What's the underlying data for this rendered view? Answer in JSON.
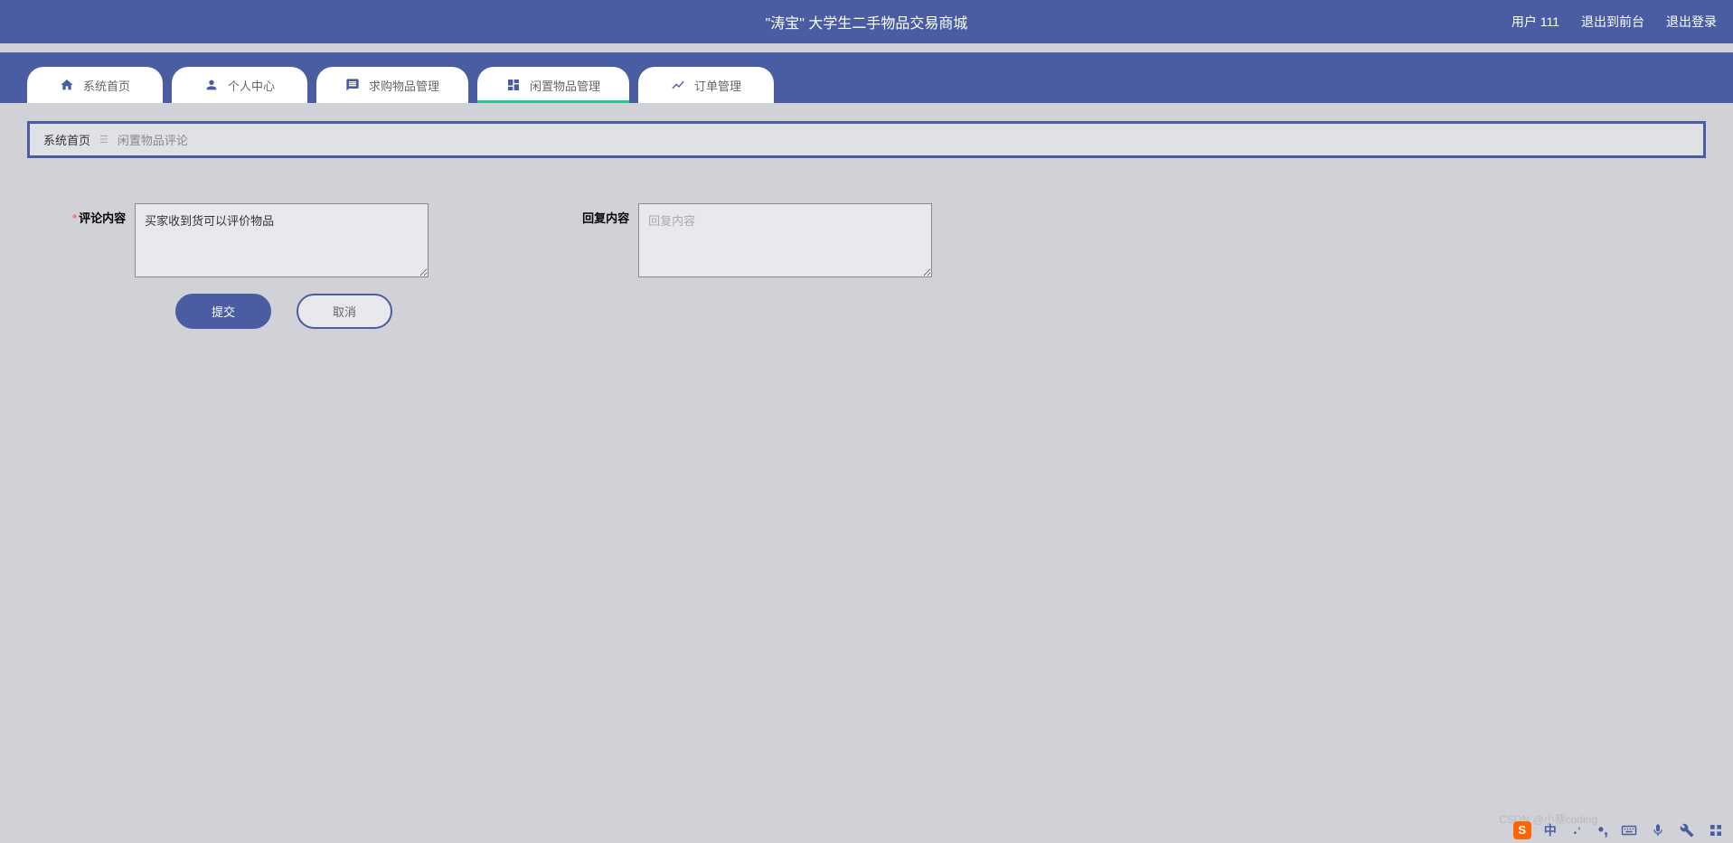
{
  "header": {
    "site_title": "\"涛宝\" 大学生二手物品交易商城",
    "user_label": "用户 111",
    "exit_front_label": "退出到前台",
    "logout_label": "退出登录"
  },
  "nav": {
    "tabs": [
      {
        "label": "系统首页",
        "icon": "home",
        "active": false
      },
      {
        "label": "个人中心",
        "icon": "person",
        "active": false
      },
      {
        "label": "求购物品管理",
        "icon": "message",
        "active": false
      },
      {
        "label": "闲置物品管理",
        "icon": "dashboard",
        "active": true
      },
      {
        "label": "订单管理",
        "icon": "chart",
        "active": false
      }
    ]
  },
  "breadcrumb": {
    "root": "系统首页",
    "current": "闲置物品评论"
  },
  "form": {
    "comment_label": "评论内容",
    "comment_value": "买家收到货可以评价物品",
    "reply_label": "回复内容",
    "reply_placeholder": "回复内容",
    "reply_value": "",
    "submit_label": "提交",
    "cancel_label": "取消"
  },
  "watermark": "CSDN @小蔡coding",
  "taskbar": {
    "ime_badge": "S",
    "ime_lang": "中"
  }
}
